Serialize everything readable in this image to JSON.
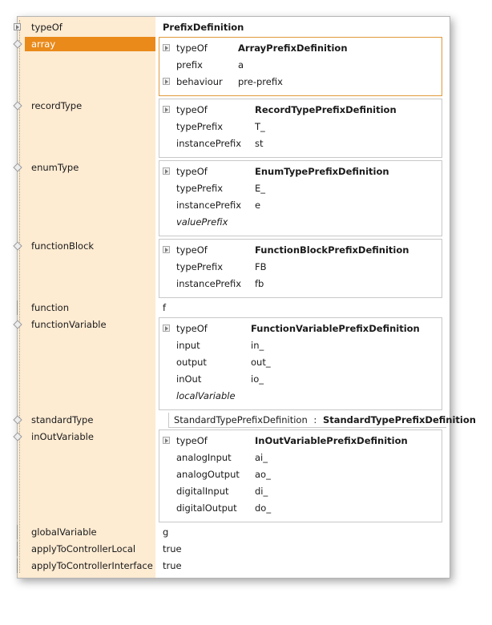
{
  "rows": {
    "typeOf": {
      "label": "typeOf",
      "value": "PrefixDefinition"
    },
    "array": {
      "label": "array",
      "props": [
        {
          "name": "typeOf",
          "value": "ArrayPrefixDefinition"
        },
        {
          "name": "prefix",
          "value": "a"
        },
        {
          "name": "behaviour",
          "value": "pre-prefix"
        }
      ]
    },
    "recordType": {
      "label": "recordType",
      "props": [
        {
          "name": "typeOf",
          "value": "RecordTypePrefixDefinition"
        },
        {
          "name": "typePrefix",
          "value": "T_"
        },
        {
          "name": "instancePrefix",
          "value": "st"
        }
      ]
    },
    "enumType": {
      "label": "enumType",
      "props": [
        {
          "name": "typeOf",
          "value": "EnumTypePrefixDefinition"
        },
        {
          "name": "typePrefix",
          "value": "E_"
        },
        {
          "name": "instancePrefix",
          "value": "e"
        },
        {
          "name": "valuePrefix",
          "value": ""
        }
      ]
    },
    "functionBlock": {
      "label": "functionBlock",
      "props": [
        {
          "name": "typeOf",
          "value": "FunctionBlockPrefixDefinition"
        },
        {
          "name": "typePrefix",
          "value": "FB"
        },
        {
          "name": "instancePrefix",
          "value": "fb"
        }
      ]
    },
    "function": {
      "label": "function",
      "value": "f"
    },
    "functionVariable": {
      "label": "functionVariable",
      "props": [
        {
          "name": "typeOf",
          "value": "FunctionVariablePrefixDefinition"
        },
        {
          "name": "input",
          "value": "in_"
        },
        {
          "name": "output",
          "value": "out_"
        },
        {
          "name": "inOut",
          "value": "io_"
        },
        {
          "name": "localVariable",
          "value": ""
        }
      ]
    },
    "standardType": {
      "label": "standardType",
      "type_label": "StandardTypePrefixDefinition",
      "separator": ":",
      "value": "StandardTypePrefixDefinition"
    },
    "inOutVariable": {
      "label": "inOutVariable",
      "props": [
        {
          "name": "typeOf",
          "value": "InOutVariablePrefixDefinition"
        },
        {
          "name": "analogInput",
          "value": "ai_"
        },
        {
          "name": "analogOutput",
          "value": "ao_"
        },
        {
          "name": "digitalInput",
          "value": "di_"
        },
        {
          "name": "digitalOutput",
          "value": "do_"
        }
      ]
    },
    "globalVariable": {
      "label": "globalVariable",
      "value": "g"
    },
    "applyToControllerLocal": {
      "label": "applyToControllerLocal",
      "value": "true"
    },
    "applyToControllerInterface": {
      "label": "applyToControllerInterface",
      "value": "true"
    }
  },
  "colors": {
    "gutter": "#fdebd2",
    "selection": "#ea8a1a",
    "selected_box_border": "#e09a3a",
    "box_border": "#c8c8c8"
  }
}
